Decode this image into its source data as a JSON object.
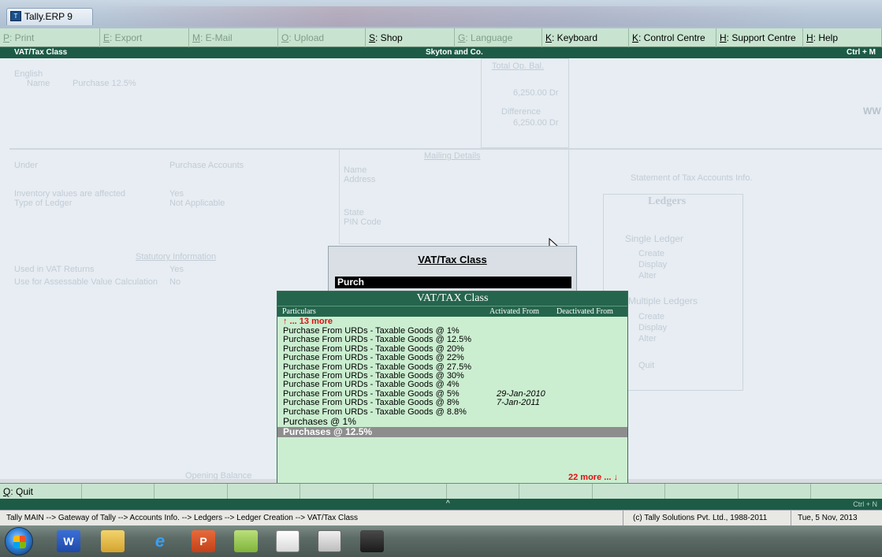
{
  "window": {
    "title": "Tally.ERP 9"
  },
  "buttons": [
    {
      "key": "P",
      "label": ": Print",
      "dim": true
    },
    {
      "key": "E",
      "label": ": Export",
      "dim": true
    },
    {
      "key": "M",
      "label": ": E-Mail",
      "dim": true
    },
    {
      "key": "O",
      "label": ": Upload",
      "dim": true
    },
    {
      "key": "S",
      "label": ": Shop",
      "dim": false
    },
    {
      "key": "G",
      "label": ": Language",
      "dim": true
    },
    {
      "key": "K",
      "label": ": Keyboard",
      "dim": false
    },
    {
      "key": "K",
      "label": ": Control Centre",
      "dim": false
    },
    {
      "key": "H",
      "label": ": Support Centre",
      "dim": false
    },
    {
      "key": "H",
      "label": ": Help",
      "dim": false
    }
  ],
  "header": {
    "left": "VAT/Tax Class",
    "center": "Skyton and Co.",
    "right": "Ctrl + M"
  },
  "background_form": {
    "english": "English",
    "name_label": "Name",
    "name_value": "Purchase 12.5%",
    "total_op_bal": "Total Op. Bal.",
    "amt1": "6,250.00 Dr",
    "difference": "Difference",
    "amt2": "6,250.00 Dr",
    "under": "Under",
    "under_value": "Purchase Accounts",
    "mailing": "Mailing Details",
    "name2": "Name",
    "address": "Address",
    "inventory": "Inventory values are affected",
    "inventory_val": "Yes",
    "type_ledger": "Type of Ledger",
    "type_ledger_val": "Not Applicable",
    "state": "State",
    "pin": "PIN Code",
    "statutory": "Statutory Information",
    "used_vat": "Used in VAT Returns",
    "used_vat_val": "Yes",
    "assess": "Use for Assessable Value Calculation",
    "assess_val": "No",
    "opening": "Opening Balance",
    "www": "WW"
  },
  "side_panel": {
    "title": "Ledgers",
    "subtitle": "Statement of Tax Accounts Info.",
    "single": "Single Ledger",
    "single_items": [
      "Create",
      "Display",
      "Alter"
    ],
    "multiple": "Multiple Ledgers",
    "multiple_items": [
      "Create",
      "Display",
      "Alter"
    ],
    "quit": "Quit"
  },
  "vat_prompt": {
    "title": "VAT/Tax Class",
    "input_value": "Purch"
  },
  "list": {
    "title": "VAT/TAX Class",
    "col_particulars": "Particulars",
    "col_activated": "Activated From",
    "col_deactivated": "Deactivated From",
    "more_top": "↑ ... 13 more",
    "items": [
      {
        "name": "Purchase From URDs - Taxable Goods @ 1%",
        "activated": ""
      },
      {
        "name": "Purchase From URDs - Taxable Goods @ 12.5%",
        "activated": ""
      },
      {
        "name": "Purchase From URDs - Taxable Goods @ 20%",
        "activated": ""
      },
      {
        "name": "Purchase From URDs - Taxable Goods @ 22%",
        "activated": ""
      },
      {
        "name": "Purchase From URDs - Taxable Goods @ 27.5%",
        "activated": ""
      },
      {
        "name": "Purchase From URDs - Taxable Goods @ 30%",
        "activated": ""
      },
      {
        "name": "Purchase From URDs - Taxable Goods @ 4%",
        "activated": ""
      },
      {
        "name": "Purchase From URDs - Taxable Goods @ 5%",
        "activated": "29-Jan-2010"
      },
      {
        "name": "Purchase From URDs - Taxable Goods @ 8%",
        "activated": "7-Jan-2011"
      },
      {
        "name": "Purchase From URDs - Taxable Goods @ 8.8%",
        "activated": ""
      }
    ],
    "item_big": "Purchases @ 1%",
    "item_selected": "Purchases @ 12.5%",
    "more_bottom": "22 more ... ↓"
  },
  "quit_button": {
    "key": "Q",
    "label": ": Quit"
  },
  "strip_right": "Ctrl + N",
  "status": {
    "path": "Tally MAIN --> Gateway of Tally --> Accounts Info. --> Ledgers --> Ledger Creation --> VAT/Tax Class",
    "copyright": "(c) Tally Solutions Pvt. Ltd., 1988-2011",
    "date": "Tue, 5 Nov, 2013"
  },
  "taskbar": {
    "icons": [
      "start-icon",
      "word-icon",
      "folder-icon",
      "ie-icon",
      "powerpoint-icon",
      "notes-icon",
      "tally-icon",
      "calculator-icon",
      "user-icon"
    ],
    "labels": [
      "W",
      "",
      "e",
      "P",
      "",
      "",
      "",
      ""
    ]
  }
}
